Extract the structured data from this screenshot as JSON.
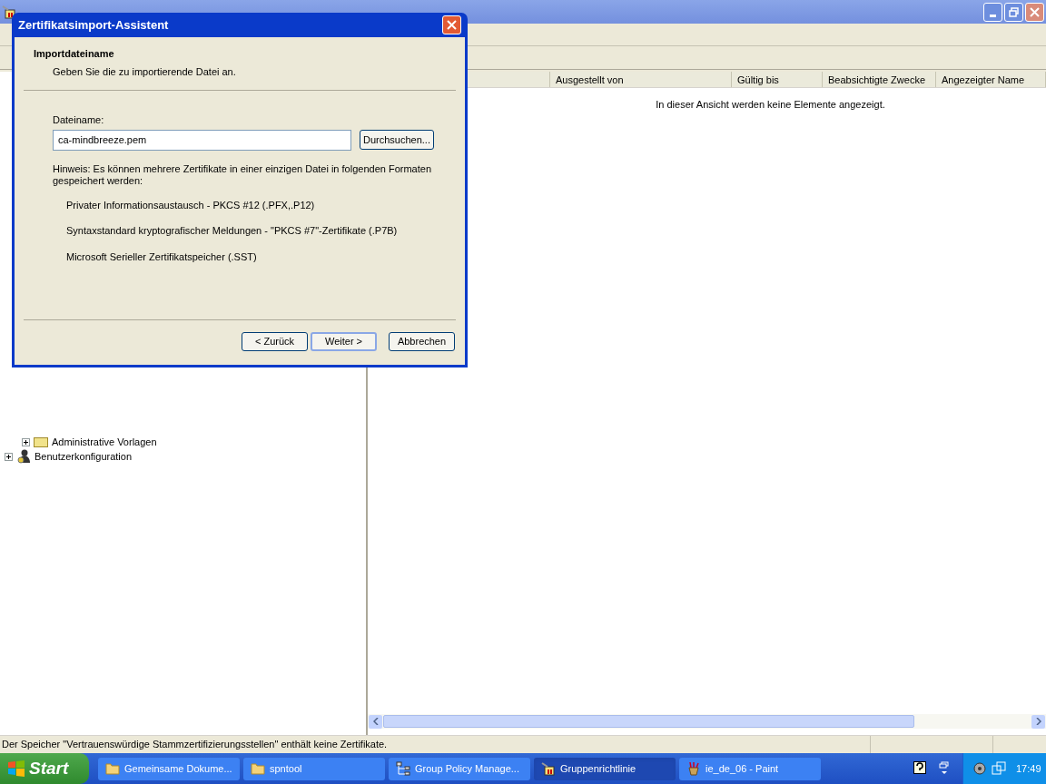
{
  "main_window": {
    "columns": [
      {
        "label": "Ausgestellt von"
      },
      {
        "label": "Gültig bis"
      },
      {
        "label": "Beabsichtigte Zwecke"
      },
      {
        "label": "Angezeigter Name"
      }
    ],
    "empty_message": "In dieser Ansicht werden keine Elemente angezeigt.",
    "tree": [
      {
        "label": "Administrative Vorlagen",
        "expanded": false,
        "kind": "folder"
      },
      {
        "label": "Benutzerkonfiguration",
        "expanded": false,
        "kind": "user"
      }
    ],
    "status_bar": "Der Speicher \"Vertrauenswürdige Stammzertifizierungsstellen\" enthält keine Zertifikate."
  },
  "dialog": {
    "title": "Zertifikatsimport-Assistent",
    "heading": "Importdateiname",
    "subheading": "Geben Sie die zu importierende Datei an.",
    "field_label": "Dateiname:",
    "field_value": "ca-mindbreeze.pem",
    "browse_button": "Durchsuchen...",
    "note": "Hinweis: Es können mehrere Zertifikate in einer einzigen Datei in folgenden Formaten gespeichert werden:",
    "formats": [
      "Privater Informationsaustausch - PKCS #12 (.PFX,.P12)",
      "Syntaxstandard kryptografischer Meldungen - \"PKCS #7\"-Zertifikate (.P7B)",
      "Microsoft Serieller Zertifikatspeicher (.SST)"
    ],
    "buttons": [
      {
        "label": "< Zurück",
        "default": false
      },
      {
        "label": "Weiter >",
        "default": true
      },
      {
        "label": "Abbrechen",
        "default": false
      }
    ]
  },
  "taskbar": {
    "start": "Start",
    "items": [
      {
        "label": "Gemeinsame Dokume...",
        "selected": false,
        "kind": "folder"
      },
      {
        "label": "spntool",
        "selected": false,
        "kind": "folder"
      },
      {
        "label": "Group Policy Manage...",
        "selected": false,
        "kind": "tree"
      },
      {
        "label": "Gruppenrichtlinie",
        "selected": true,
        "kind": "policy"
      },
      {
        "label": "ie_de_06 - Paint",
        "selected": false,
        "kind": "paint"
      }
    ],
    "clock": "17:49"
  }
}
